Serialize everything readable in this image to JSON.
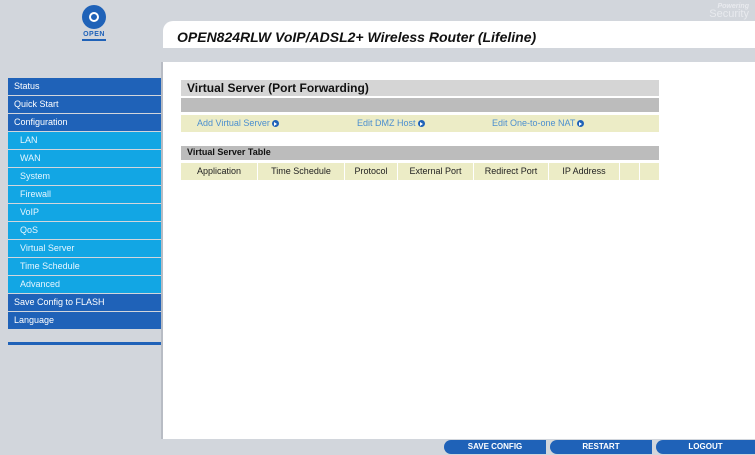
{
  "brand": {
    "logo_text": "OPEN",
    "tagline_1": "Powering",
    "tagline_2": "Security"
  },
  "header": {
    "title": "OPEN824RLW VoIP/ADSL2+ Wireless Router (Lifeline)"
  },
  "sidebar": {
    "items": [
      {
        "label": "Status",
        "level": "main"
      },
      {
        "label": "Quick Start",
        "level": "main"
      },
      {
        "label": "Configuration",
        "level": "main"
      },
      {
        "label": "LAN",
        "level": "sub"
      },
      {
        "label": "WAN",
        "level": "sub"
      },
      {
        "label": "System",
        "level": "sub"
      },
      {
        "label": "Firewall",
        "level": "sub"
      },
      {
        "label": "VoIP",
        "level": "sub"
      },
      {
        "label": "QoS",
        "level": "sub"
      },
      {
        "label": "Virtual Server",
        "level": "sub"
      },
      {
        "label": "Time Schedule",
        "level": "sub"
      },
      {
        "label": "Advanced",
        "level": "sub"
      },
      {
        "label": "Save Config to FLASH",
        "level": "main"
      },
      {
        "label": "Language",
        "level": "main"
      }
    ]
  },
  "main": {
    "section_title": "Virtual Server (Port Forwarding)",
    "links": {
      "add_virtual_server": "Add Virtual Server",
      "edit_dmz_host": "Edit DMZ Host",
      "edit_one_to_one_nat": "Edit One-to-one NAT"
    },
    "table": {
      "title": "Virtual Server Table",
      "columns": [
        "Application",
        "Time Schedule",
        "Protocol",
        "External Port",
        "Redirect Port",
        "IP Address"
      ],
      "rows": []
    }
  },
  "footer": {
    "save_config": "SAVE CONFIG",
    "restart": "RESTART",
    "logout": "LOGOUT"
  },
  "colors": {
    "nav_main": "#1f62b8",
    "nav_sub": "#12a6e4",
    "link": "#4c8fcf",
    "row_bg": "#ececc6"
  }
}
